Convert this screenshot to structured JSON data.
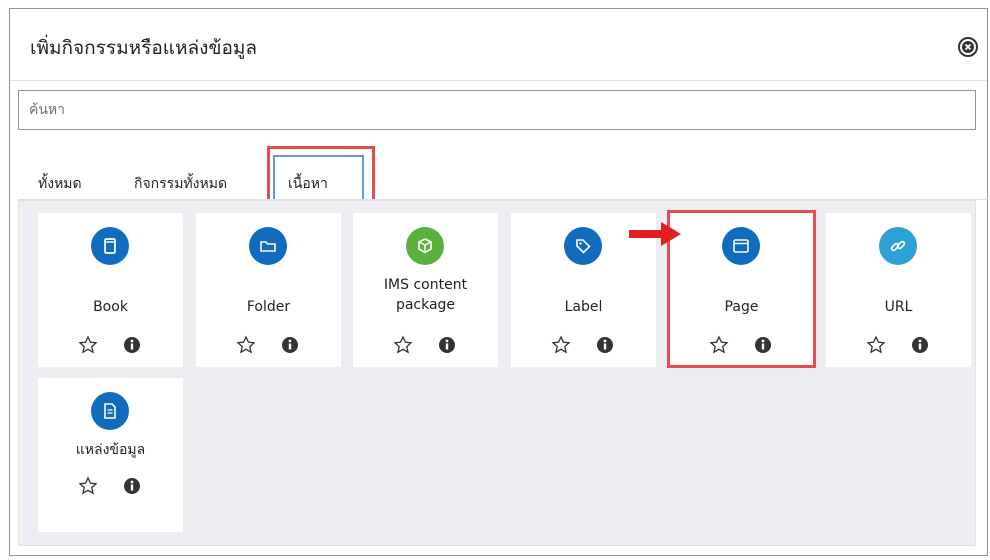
{
  "dialog": {
    "title": "เพิ่มกิจกรรมหรือแหล่งข้อมูล",
    "close_icon": "close-circle-icon"
  },
  "search": {
    "placeholder": "ค้นหา",
    "value": ""
  },
  "tabs": [
    {
      "label": "ทั้งหมด",
      "active": false
    },
    {
      "label": "กิจกรรมทั้งหมด",
      "active": false
    },
    {
      "label": "เนื้อหา",
      "active": true
    }
  ],
  "items": [
    {
      "name": "Book",
      "icon": "book-icon",
      "color": "#0f6cbf"
    },
    {
      "name": "Folder",
      "icon": "folder-icon",
      "color": "#0f6cbf"
    },
    {
      "name": "IMS content package",
      "icon": "package-icon",
      "color": "#5bb13e"
    },
    {
      "name": "Label",
      "icon": "tag-icon",
      "color": "#0f6cbf"
    },
    {
      "name": "Page",
      "icon": "page-icon",
      "color": "#0f6cbf"
    },
    {
      "name": "URL",
      "icon": "link-icon",
      "color": "#2ea2d6"
    },
    {
      "name": "แหล่งข้อมูล",
      "icon": "file-icon",
      "color": "#0f6cbf"
    }
  ],
  "actions": {
    "star_icon": "star-outline-icon",
    "info_icon": "info-circle-icon"
  },
  "annotations": {
    "highlight_color": "#e74c4c",
    "arrow_icon": "red-arrow-icon"
  }
}
